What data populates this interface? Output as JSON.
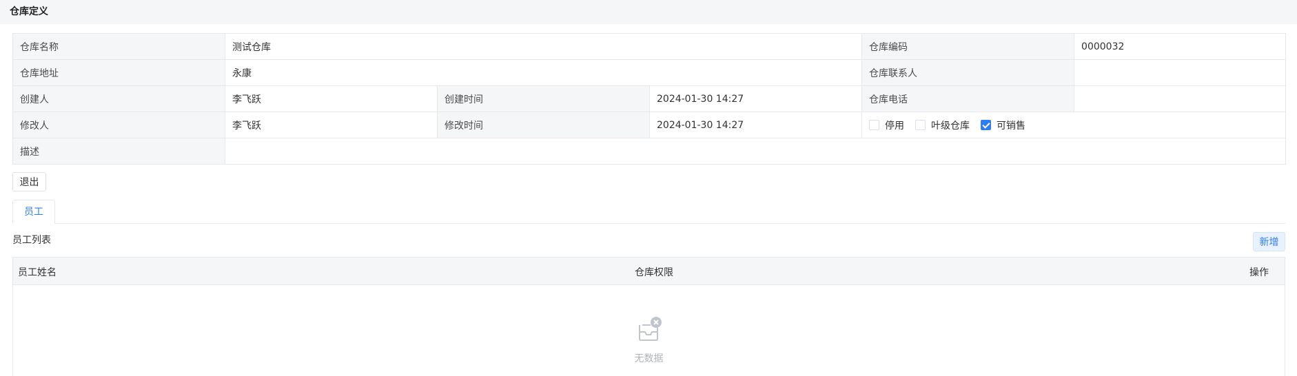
{
  "header": {
    "title": "仓库定义"
  },
  "form": {
    "warehouse_name_label": "仓库名称",
    "warehouse_name": "测试仓库",
    "warehouse_code_label": "仓库编码",
    "warehouse_code": "0000032",
    "address_label": "仓库地址",
    "address": "永康",
    "contact_label": "仓库联系人",
    "contact": "",
    "creator_label": "创建人",
    "creator": "李飞跃",
    "created_time_label": "创建时间",
    "created_time": "2024-01-30 14:27",
    "phone_label": "仓库电话",
    "phone": "",
    "modifier_label": "修改人",
    "modifier": "李飞跃",
    "modified_time_label": "修改时间",
    "modified_time": "2024-01-30 14:27",
    "description_label": "描述",
    "description": "",
    "checkboxes": [
      {
        "label": "停用",
        "checked": false
      },
      {
        "label": "叶级仓库",
        "checked": false
      },
      {
        "label": "可销售",
        "checked": true
      }
    ]
  },
  "actions": {
    "exit_label": "退出"
  },
  "tabs": [
    {
      "label": "员工",
      "active": true
    }
  ],
  "employee_section": {
    "title": "员工列表",
    "add_label": "新增",
    "columns": [
      "员工姓名",
      "仓库权限",
      "操作"
    ],
    "rows": [],
    "empty_text": "无数据"
  },
  "colors": {
    "accent": "#2f7df6",
    "label_bg": "#f5f6f8",
    "border": "#e6e8eb"
  }
}
